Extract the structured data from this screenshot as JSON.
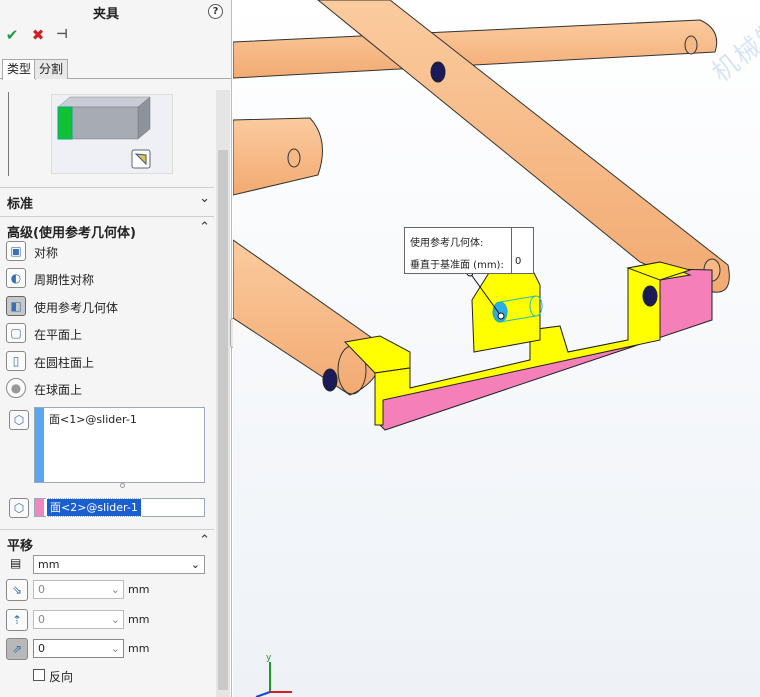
{
  "panel": {
    "title": "夹具",
    "help_icon": "?",
    "tabs": [
      "类型",
      "分割"
    ],
    "sections": {
      "standard": "标准",
      "advanced": "高级(使用参考几何体)",
      "translation": "平移"
    },
    "options": [
      {
        "label": "对称",
        "icon": "symmetry-icon"
      },
      {
        "label": "周期性对称",
        "icon": "cyclic-symmetry-icon"
      },
      {
        "label": "使用参考几何体",
        "icon": "reference-geometry-icon",
        "selected": true
      },
      {
        "label": "在平面上",
        "icon": "on-flat-face-icon"
      },
      {
        "label": "在圆柱面上",
        "icon": "on-cylindrical-face-icon"
      },
      {
        "label": "在球面上",
        "icon": "on-spherical-face-icon"
      }
    ],
    "face_list": [
      "面<1>@slider-1"
    ],
    "reference_face": "面<2>@slider-1",
    "unit": "mm",
    "translations": [
      {
        "value": "0",
        "unit": "mm",
        "enabled": false
      },
      {
        "value": "0",
        "unit": "mm",
        "enabled": false
      },
      {
        "value": "0",
        "unit": "mm",
        "enabled": true
      }
    ],
    "reverse_label": "反向"
  },
  "tooltip": {
    "row1": "使用参考几何体:",
    "row2": "垂直于基准面 (mm):",
    "value": "0"
  },
  "watermark": "机械制图网 xxage.com",
  "colors": {
    "link_orange": "#f8bb8a",
    "part_yellow": "#ffff00",
    "face_pink": "#f57fb8",
    "selection_blue": "#1a5fd0",
    "accept_green": "#1f9a3a",
    "cancel_red": "#d02020"
  }
}
